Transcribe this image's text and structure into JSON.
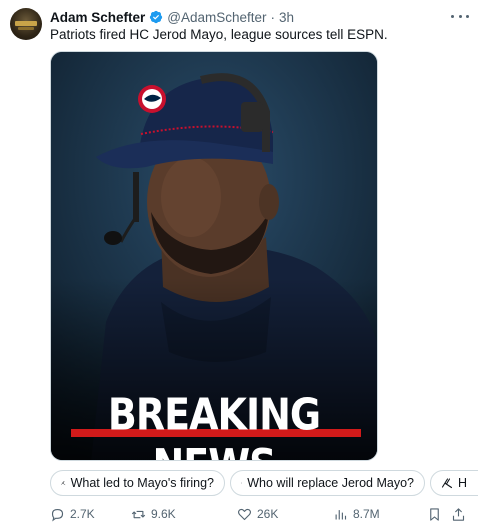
{
  "author": {
    "name": "Adam Schefter",
    "handle": "@AdamSchefter",
    "separator": "·",
    "time": "3h"
  },
  "tweet_text": "Patriots fired HC Jerod Mayo, league sources tell ESPN.",
  "media": {
    "overlay_text": "BREAKING NEWS",
    "accent_color": "#d11a1a"
  },
  "grok_chips": [
    {
      "label": "What led to Mayo's firing?"
    },
    {
      "label": "Who will replace Jerod Mayo?"
    },
    {
      "label": "H"
    }
  ],
  "actions": {
    "replies": "2.7K",
    "reposts": "9.6K",
    "likes": "26K",
    "views": "8.7M"
  },
  "icons": {
    "verified": "verified-badge-icon",
    "more": "more-icon",
    "grok": "grok-icon",
    "reply": "reply-icon",
    "repost": "repost-icon",
    "like": "heart-icon",
    "views": "views-icon",
    "bookmark": "bookmark-icon",
    "share": "share-icon"
  },
  "colors": {
    "verified_blue": "#1d9bf0",
    "text_secondary": "#536471"
  }
}
